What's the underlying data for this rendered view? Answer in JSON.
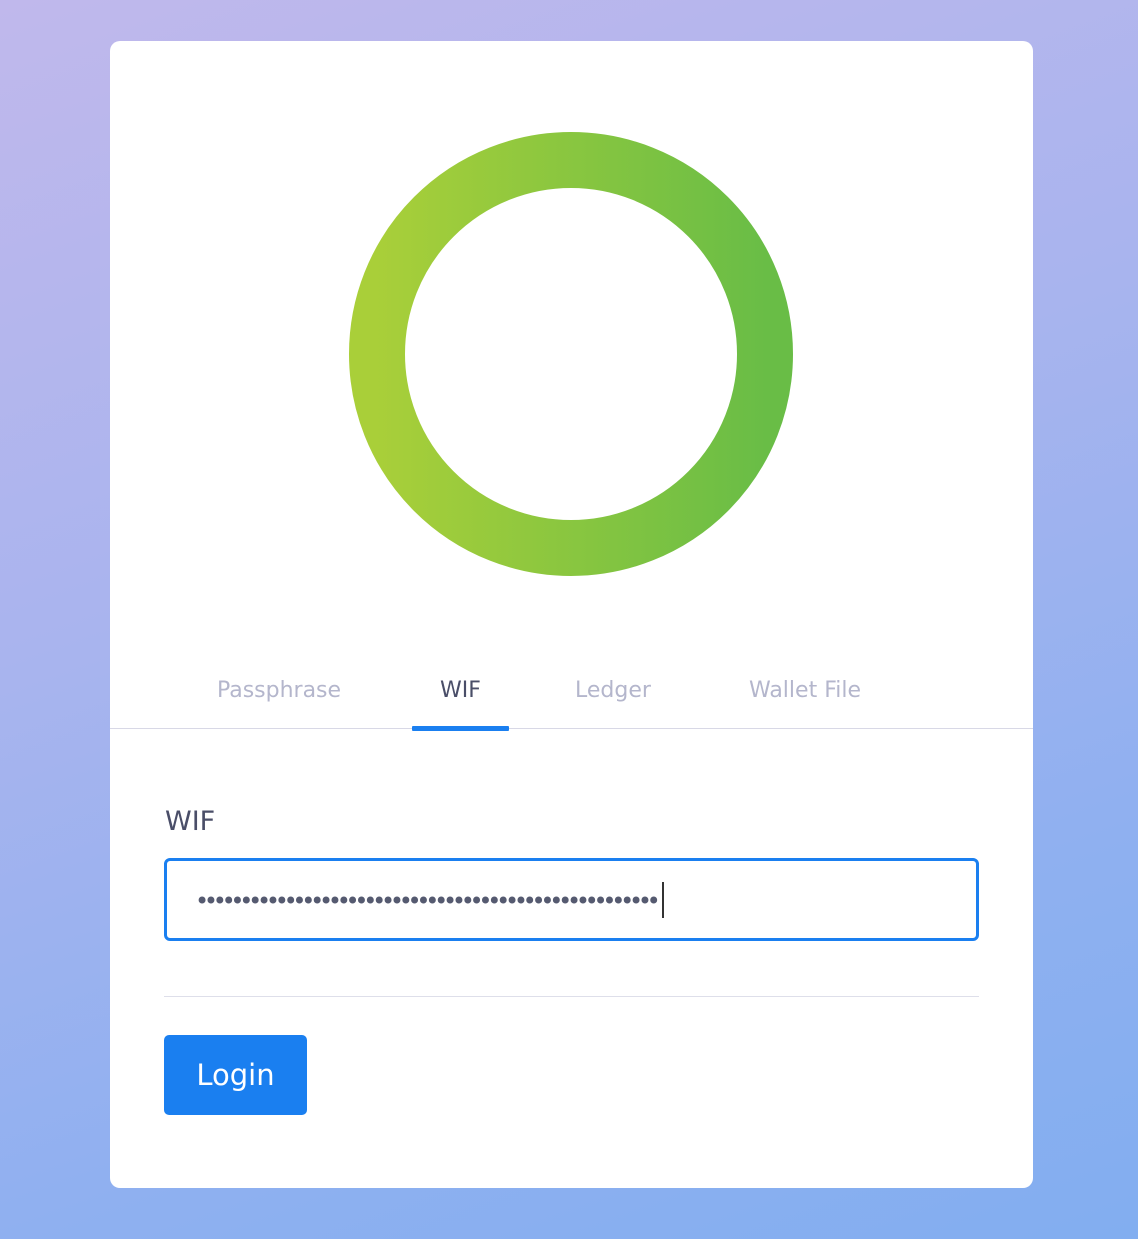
{
  "colors": {
    "accent": "#1a7ff0",
    "logo_gradient_start": "#a6cd3a",
    "logo_gradient_end": "#6cbe45",
    "tab_inactive": "#b4b6cc",
    "tab_active": "#4a4e68"
  },
  "logo": {
    "icon": "green-ring-logo"
  },
  "tabs": [
    {
      "label": "Passphrase",
      "active": false
    },
    {
      "label": "WIF",
      "active": true
    },
    {
      "label": "Ledger",
      "active": false
    },
    {
      "label": "Wallet File",
      "active": false
    }
  ],
  "form": {
    "wif_label": "WIF",
    "wif_masked_value": "••••••••••••••••••••••••••••••••••••••••••••••••••••",
    "wif_placeholder": "",
    "login_label": "Login"
  }
}
